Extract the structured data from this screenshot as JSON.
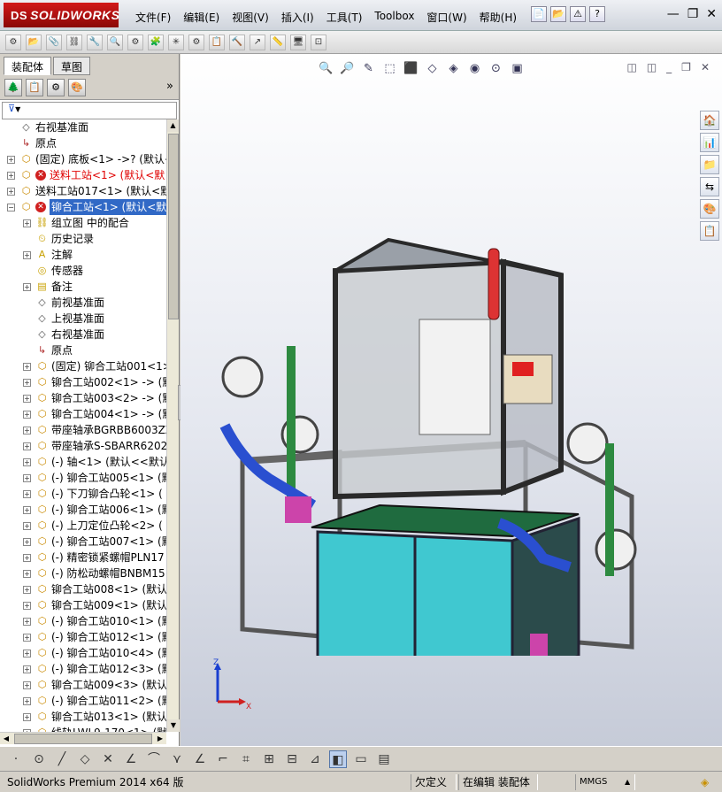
{
  "title_bar": {
    "logo_ds": "DS",
    "logo_text": "SOLIDWORKS",
    "menus": [
      "文件(F)",
      "编辑(E)",
      "视图(V)",
      "插入(I)",
      "工具(T)",
      "Toolbox",
      "窗口(W)",
      "帮助(H)"
    ],
    "window_controls": [
      "—",
      "❐",
      "✕"
    ]
  },
  "quick_access": [
    "📄",
    "📂",
    "⚠",
    "?"
  ],
  "command_toolbar": [
    "⚙",
    "📂",
    "📎",
    "⛓",
    "🔧",
    "🔍",
    "⚙",
    "🧩",
    "✳",
    "⚙",
    "📋",
    "🔨",
    "↗",
    "📏",
    "🖥",
    "⊡"
  ],
  "panel": {
    "tabs": [
      "装配体",
      "草图"
    ],
    "active_tab": 0,
    "toolbar_icons": [
      "tree-icon",
      "property-icon",
      "config-icon",
      "appearance-icon"
    ],
    "expand_glyph": "»",
    "filter_glyph": "▼",
    "items": [
      {
        "t": "右视基准面",
        "icon": "plane",
        "indent": 0,
        "pm": ""
      },
      {
        "t": "原点",
        "icon": "origin",
        "indent": 0,
        "pm": ""
      },
      {
        "t": "(固定) 底板<1> ->? (默认<",
        "icon": "asm",
        "indent": 0,
        "pm": "+"
      },
      {
        "t": "送料工站<1> (默认<默",
        "icon": "asm",
        "indent": 0,
        "pm": "+",
        "err": true,
        "red": true
      },
      {
        "t": "送料工站017<1> (默认<默",
        "icon": "asm",
        "indent": 0,
        "pm": "+"
      },
      {
        "t": "铆合工站<1> (默认<默",
        "icon": "asm",
        "indent": 0,
        "pm": "−",
        "err": true,
        "sel": true
      },
      {
        "t": "组立图 中的配合",
        "icon": "mate",
        "indent": 1,
        "pm": "+"
      },
      {
        "t": "历史记录",
        "icon": "history",
        "indent": 1,
        "pm": ""
      },
      {
        "t": "注解",
        "icon": "annot",
        "indent": 1,
        "pm": "+"
      },
      {
        "t": "传感器",
        "icon": "sensor",
        "indent": 1,
        "pm": ""
      },
      {
        "t": "备注",
        "icon": "note",
        "indent": 1,
        "pm": "+"
      },
      {
        "t": "前视基准面",
        "icon": "plane",
        "indent": 1,
        "pm": ""
      },
      {
        "t": "上视基准面",
        "icon": "plane",
        "indent": 1,
        "pm": ""
      },
      {
        "t": "右视基准面",
        "icon": "plane",
        "indent": 1,
        "pm": ""
      },
      {
        "t": "原点",
        "icon": "origin",
        "indent": 1,
        "pm": ""
      },
      {
        "t": "(固定) 铆合工站001<1>",
        "icon": "asm",
        "indent": 1,
        "pm": "+"
      },
      {
        "t": "铆合工站002<1> -> (默",
        "icon": "asm",
        "indent": 1,
        "pm": "+"
      },
      {
        "t": "铆合工站003<2> -> (默",
        "icon": "asm",
        "indent": 1,
        "pm": "+"
      },
      {
        "t": "铆合工站004<1> -> (默",
        "icon": "asm",
        "indent": 1,
        "pm": "+"
      },
      {
        "t": "带座轴承BGRBB6003ZZ-3",
        "icon": "asm",
        "indent": 1,
        "pm": "+"
      },
      {
        "t": "带座轴承S-SBARR6202ZZ",
        "icon": "asm",
        "indent": 1,
        "pm": "+"
      },
      {
        "t": "(-) 轴<1> (默认<<默认",
        "icon": "asm",
        "indent": 1,
        "pm": "+"
      },
      {
        "t": "(-) 铆合工站005<1> (默",
        "icon": "asm",
        "indent": 1,
        "pm": "+"
      },
      {
        "t": "(-) 下刀铆合凸轮<1> (",
        "icon": "asm",
        "indent": 1,
        "pm": "+"
      },
      {
        "t": "(-) 铆合工站006<1> (默",
        "icon": "asm",
        "indent": 1,
        "pm": "+"
      },
      {
        "t": "(-) 上刀定位凸轮<2> (",
        "icon": "asm",
        "indent": 1,
        "pm": "+"
      },
      {
        "t": "(-) 铆合工站007<1> (默",
        "icon": "asm",
        "indent": 1,
        "pm": "+"
      },
      {
        "t": "(-) 精密锁紧螺帽PLN17",
        "icon": "asm",
        "indent": 1,
        "pm": "+"
      },
      {
        "t": "(-) 防松动螺帽BNBM15<",
        "icon": "asm",
        "indent": 1,
        "pm": "+"
      },
      {
        "t": "铆合工站008<1> (默认<",
        "icon": "asm",
        "indent": 1,
        "pm": "+"
      },
      {
        "t": "铆合工站009<1> (默认<",
        "icon": "asm",
        "indent": 1,
        "pm": "+"
      },
      {
        "t": "(-) 铆合工站010<1> (默",
        "icon": "asm",
        "indent": 1,
        "pm": "+"
      },
      {
        "t": "(-) 铆合工站012<1> (默",
        "icon": "asm",
        "indent": 1,
        "pm": "+"
      },
      {
        "t": "(-) 铆合工站010<4> (默",
        "icon": "asm",
        "indent": 1,
        "pm": "+"
      },
      {
        "t": "(-) 铆合工站012<3> (默",
        "icon": "asm",
        "indent": 1,
        "pm": "+"
      },
      {
        "t": "铆合工站009<3> (默认<",
        "icon": "asm",
        "indent": 1,
        "pm": "+"
      },
      {
        "t": "(-) 铆合工站011<2> (默",
        "icon": "asm",
        "indent": 1,
        "pm": "+"
      },
      {
        "t": "铆合工站013<1> (默认<",
        "icon": "asm",
        "indent": 1,
        "pm": "+"
      },
      {
        "t": "线轨LWL9-170<1> (默认",
        "icon": "asm",
        "indent": 1,
        "pm": "+"
      }
    ]
  },
  "viewport": {
    "heads_up_icons": [
      "🔍",
      "🔎",
      "✎",
      "⬚",
      "⬛",
      "◇",
      "◈",
      "◉",
      "⊙",
      "▣"
    ],
    "window_controls": [
      "◫",
      "◫",
      "_",
      "❐",
      "✕"
    ],
    "task_pane_icons": [
      "🏠",
      "📊",
      "📁",
      "⇆",
      "🎨",
      "📋"
    ],
    "triad": {
      "z": "Z",
      "x": "X"
    }
  },
  "bottom_toolbar": [
    "·",
    "⊙",
    "╱",
    "◇",
    "✕",
    "∠",
    "⌒",
    "⋎",
    "∠",
    "⌐",
    "⌗",
    "⊞",
    "⊟",
    "⊿",
    "◧",
    "▭",
    "▤"
  ],
  "status": {
    "app": "SolidWorks Premium 2014 x64 版",
    "under_defined": "欠定义",
    "editing": "在编辑 装配体",
    "units": "MMGS",
    "units_caret": "▲",
    "tag_icon": "tag-icon"
  }
}
